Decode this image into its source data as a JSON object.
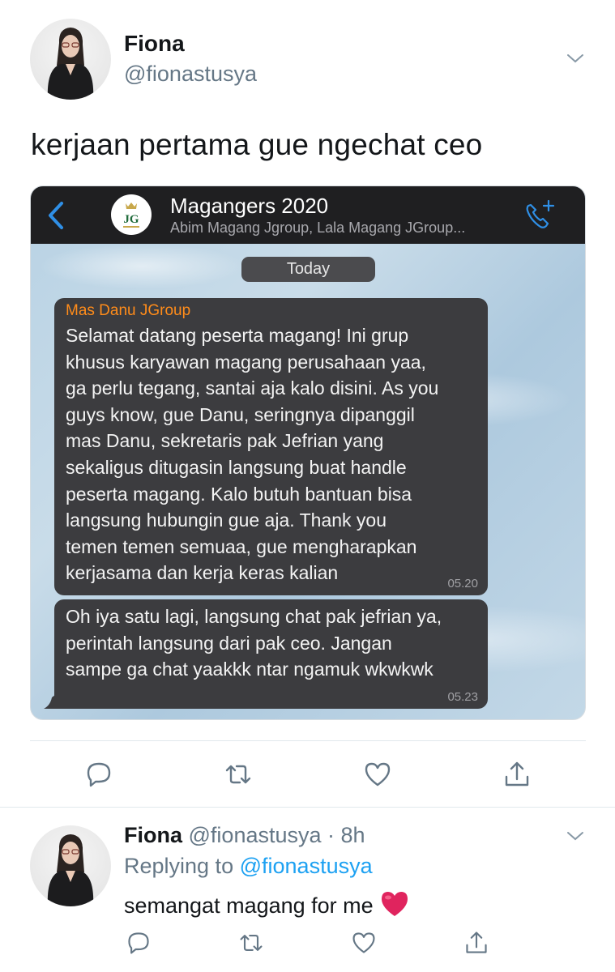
{
  "tweet": {
    "name": "Fiona",
    "handle": "@fionastusya",
    "text": "kerjaan pertama gue ngechat ceo"
  },
  "chat": {
    "group_name": "Magangers 2020",
    "group_members": "Abim Magang Jgroup, Lala Magang JGroup...",
    "group_avatar_text": "JG",
    "date_label": "Today",
    "messages": [
      {
        "sender": "Mas Danu JGroup",
        "text": "Selamat datang peserta magang! Ini grup\nkhusus karyawan magang perusahaan yaa,\nga perlu tegang, santai aja kalo disini. As you\nguys know, gue Danu, seringnya dipanggil\nmas Danu, sekretaris pak Jefrian yang\nsekaligus ditugasin langsung buat handle\npeserta magang. Kalo butuh bantuan bisa\nlangsung hubungin gue aja. Thank you\ntemen temen semuaa, gue mengharapkan\nkerjasama dan kerja keras kalian",
        "time": "05.20"
      },
      {
        "text": "Oh iya satu lagi, langsung chat pak jefrian ya,\nperintah langsung dari pak ceo. Jangan\nsampe ga chat yaakkk ntar ngamuk wkwkwk",
        "time": "05.23"
      }
    ]
  },
  "reply": {
    "name": "Fiona",
    "handle_time": "@fionastusya · 8h",
    "replying_prefix": "Replying to",
    "replying_to": "@fionastusya",
    "text": "semangat magang for me"
  },
  "icons": [
    "chevron-down-icon",
    "back-icon",
    "add-call-icon",
    "reply-icon",
    "retweet-icon",
    "like-icon",
    "share-icon",
    "red-heart-emoji"
  ],
  "colors": {
    "link_blue": "#1da1f2",
    "secondary_text": "#657786",
    "sender_orange": "#ff8c1a",
    "ios_blue": "#2f8fe6",
    "heart_red": "#e0245e"
  }
}
